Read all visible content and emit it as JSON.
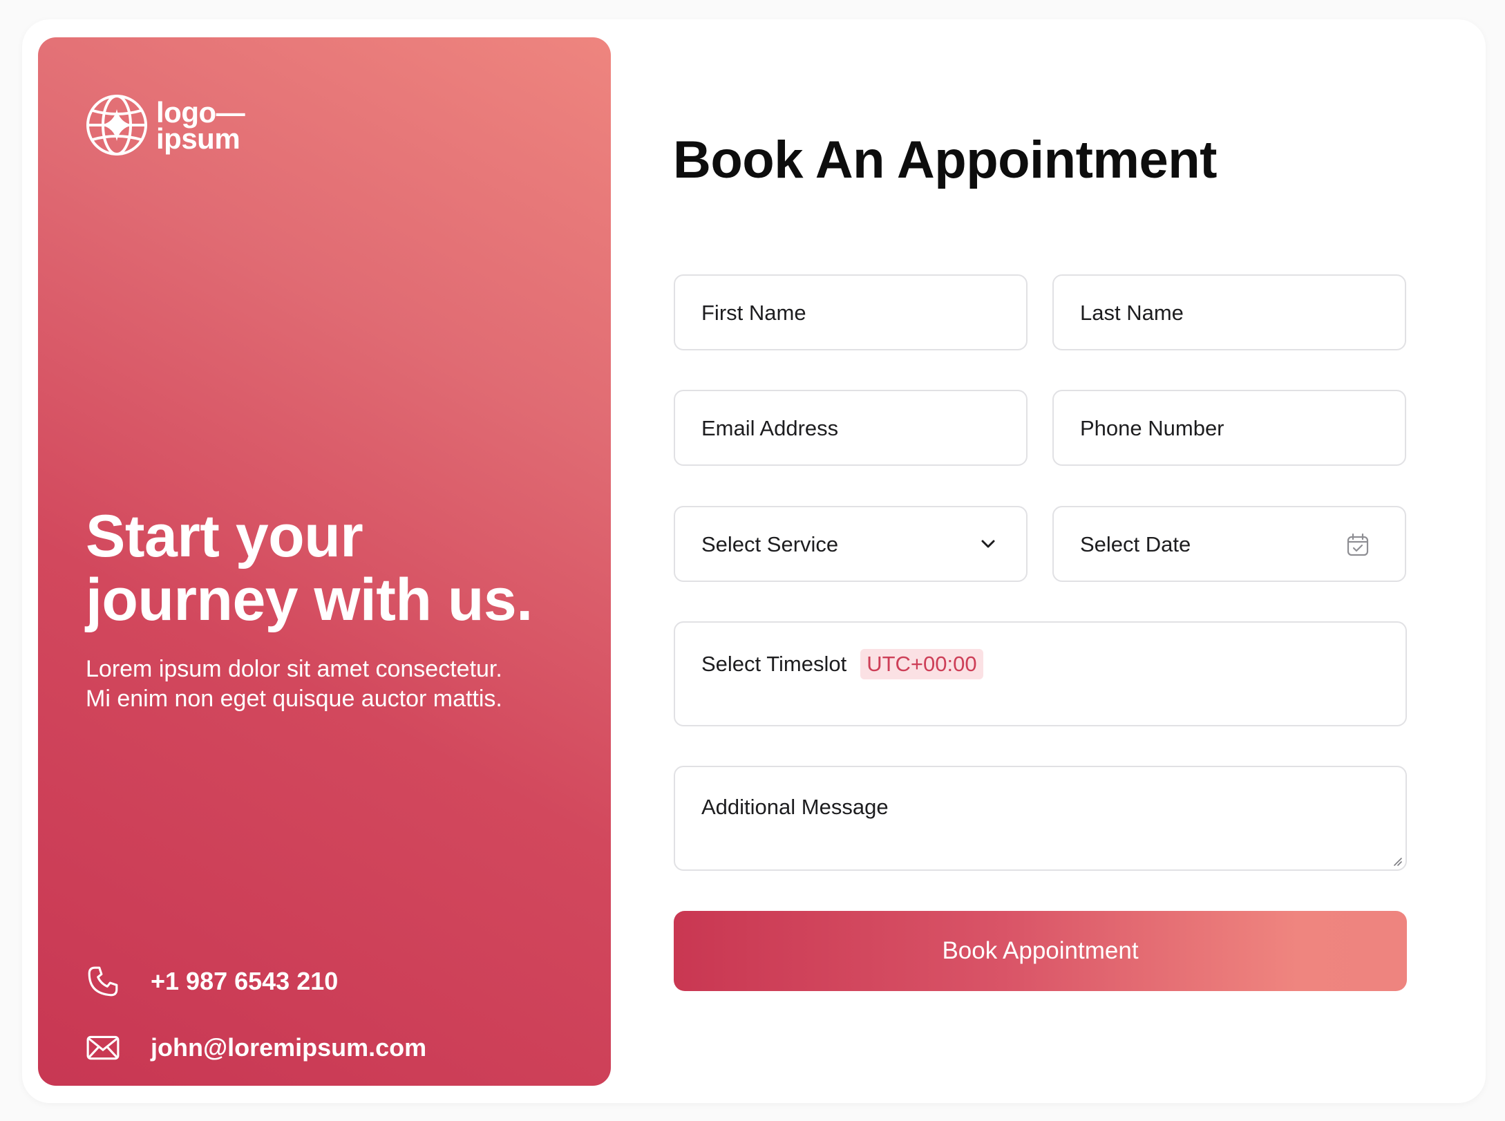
{
  "brand": {
    "logo_line1": "logo—",
    "logo_line2": "ipsum",
    "logo_icon": "globe-sparkle-icon"
  },
  "hero": {
    "headline": "Start your journey with us.",
    "subtext_line1": "Lorem ipsum dolor sit amet consectetur.",
    "subtext_line2": "Mi enim non eget quisque auctor mattis.",
    "gradient_colors": [
      "#ee857f",
      "#c83753"
    ]
  },
  "contact": {
    "phone": "+1 987 6543 210",
    "phone_icon": "phone-icon",
    "email": "john@loremipsum.com",
    "email_icon": "mail-icon"
  },
  "form": {
    "title": "Book An Appointment",
    "first_name": "First Name",
    "last_name": "Last Name",
    "email": "Email Address",
    "phone": "Phone Number",
    "service": "Select Service",
    "service_icon": "chevron-down-icon",
    "date": "Select Date",
    "date_icon": "calendar-icon",
    "timeslot": "Select Timeslot",
    "timezone": "UTC+00:00",
    "message": "Additional Message",
    "submit": "Book Appointment"
  },
  "colors": {
    "accent": "#c83753",
    "accent_light": "#ee857f",
    "badge_bg": "#fbe1e4"
  }
}
